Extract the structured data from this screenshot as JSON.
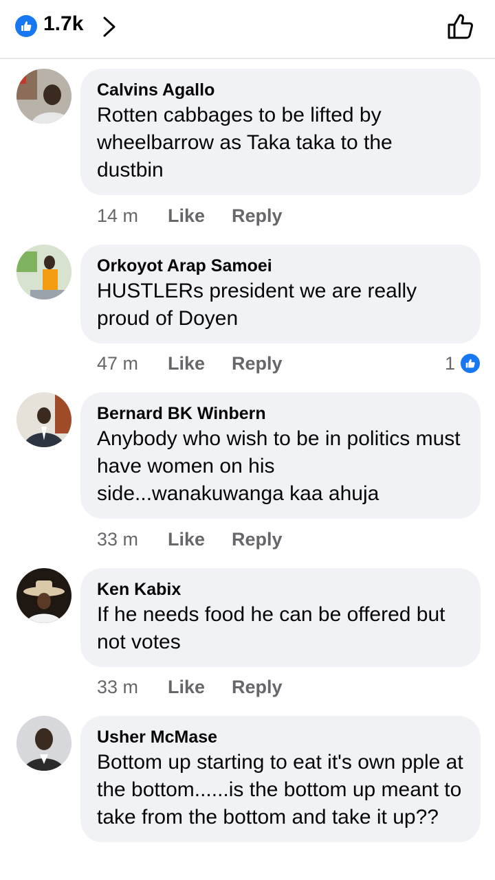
{
  "header": {
    "like_count": "1.7k",
    "icons": [
      "like-reaction-icon",
      "chevron-right-icon",
      "thumbs-up-outline-icon"
    ],
    "accent_color": "#1877f2"
  },
  "comments": [
    {
      "name": "Calvins Agallo",
      "text": "Rotten cabbages to be lifted by wheelbarrow as Taka taka to the dustbin",
      "time": "14 m",
      "like": "Like",
      "reply": "Reply"
    },
    {
      "name": "Orkoyot Arap Samoei",
      "text": "HUSTLERs president we are really proud of Doyen",
      "time": "47 m",
      "like": "Like",
      "reply": "Reply",
      "reactions": "1"
    },
    {
      "name": "Bernard BK Winbern",
      "text": "Anybody who wish to be in politics must have women on his side...wanakuwanga kaa ahuja",
      "time": "33 m",
      "like": "Like",
      "reply": "Reply"
    },
    {
      "name": "Ken Kabix",
      "text": "If he needs food he can be offered but not votes",
      "time": "33 m",
      "like": "Like",
      "reply": "Reply"
    },
    {
      "name": "Usher McMase",
      "text": "Bottom up starting to eat it's own pple at the bottom......is the bottom up meant to take from the bottom and take it up??"
    }
  ]
}
